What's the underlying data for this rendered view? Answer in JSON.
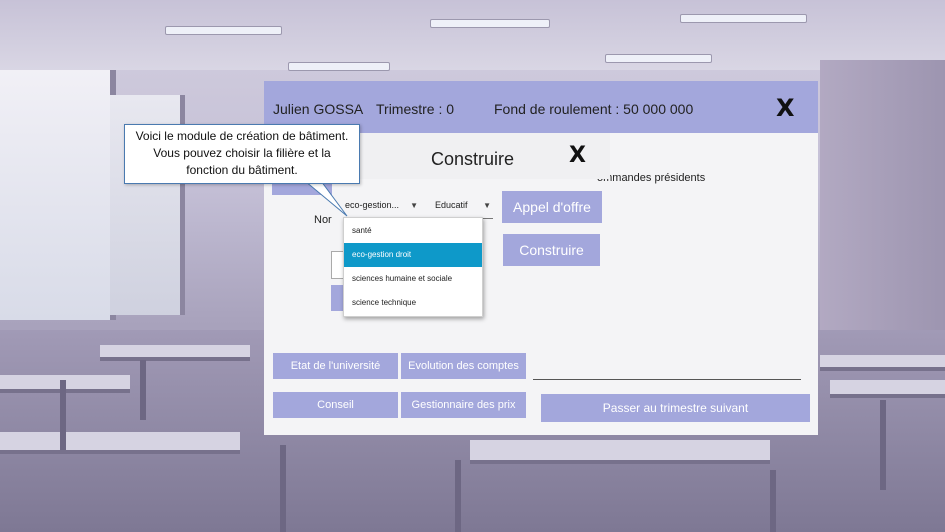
{
  "header": {
    "player_name": "Julien GOSSA",
    "trimestre": "Trimestre :  0",
    "fond": "Fond de roulement : 50 000 000",
    "close": "X"
  },
  "dialog": {
    "title": "Construire",
    "close": "X",
    "filiere_value": "eco-gestion...",
    "fonction_value": "Educatif",
    "name_label_partial": "Nor"
  },
  "dropdown": {
    "options": [
      "santé",
      "eco-gestion droit",
      "sciences humaine et sociale",
      "science technique"
    ],
    "selected_index": 1
  },
  "right_panel": {
    "commandes_text": "ommandes présidents",
    "appel_offre": "Appel d'offre",
    "construire": "Construire"
  },
  "bottom": {
    "etat": "Etat de l'université",
    "evolution": "Evolution des comptes",
    "conseil": "Conseil",
    "gestionnaire": "Gestionnaire des prix",
    "passer": "Passer au trimestre suivant"
  },
  "tooltip": {
    "text": "Voici le module de création de bâtiment. Vous pouvez choisir la filière et la fonction du bâtiment."
  },
  "colors": {
    "accent": "#a3a7dc",
    "selected": "#0e99c9"
  }
}
